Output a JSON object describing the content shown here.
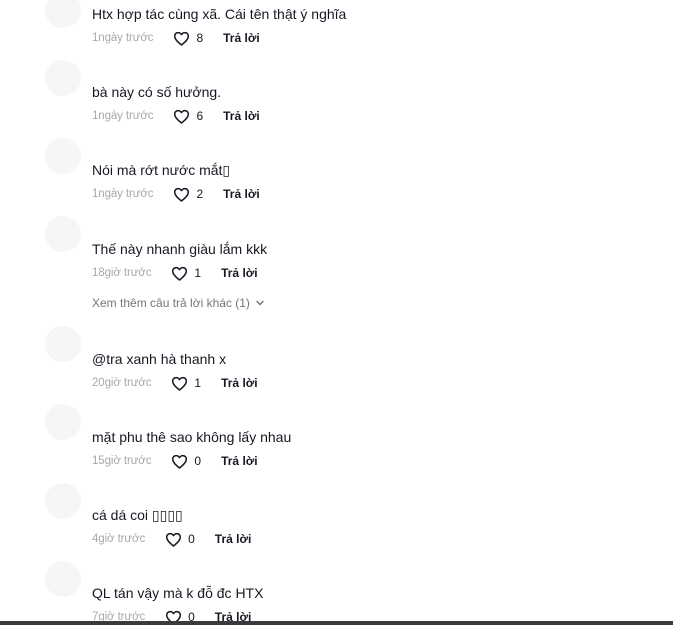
{
  "comments": [
    {
      "text": "Htx hợp tác cùng xã. Cái tên thật ý nghĩa",
      "time": "1ngày trước",
      "likes": "8",
      "reply": "Trả lời"
    },
    {
      "text": "bà này có số hưởng.",
      "time": "1ngày trước",
      "likes": "6",
      "reply": "Trả lời"
    },
    {
      "text": "Nói mà rớt nước mắt▯",
      "time": "1ngày trước",
      "likes": "2",
      "reply": "Trả lời"
    },
    {
      "text": "Thế này nhanh giàu lắm kkk",
      "time": "18giờ trước",
      "likes": "1",
      "reply": "Trả lời"
    },
    {
      "text": "@tra xanh hà thanh x",
      "time": "20giờ trước",
      "likes": "1",
      "reply": "Trả lời"
    },
    {
      "text": "mặt phu thê sao không lấy nhau",
      "time": "15giờ trước",
      "likes": "0",
      "reply": "Trả lời"
    },
    {
      "text": "cá dá coi ▯▯▯▯",
      "time": "4giờ trước",
      "likes": "0",
      "reply": "Trả lời"
    },
    {
      "text": "QL tán vậy mà k đỗ đc HTX",
      "time": "7giờ trước",
      "likes": "0",
      "reply": "Trả lời"
    }
  ],
  "more_replies": "Xem thêm câu trả lời khác (1)",
  "icons": {
    "like": "heart-outline-icon",
    "expand": "chevron-down-icon"
  }
}
